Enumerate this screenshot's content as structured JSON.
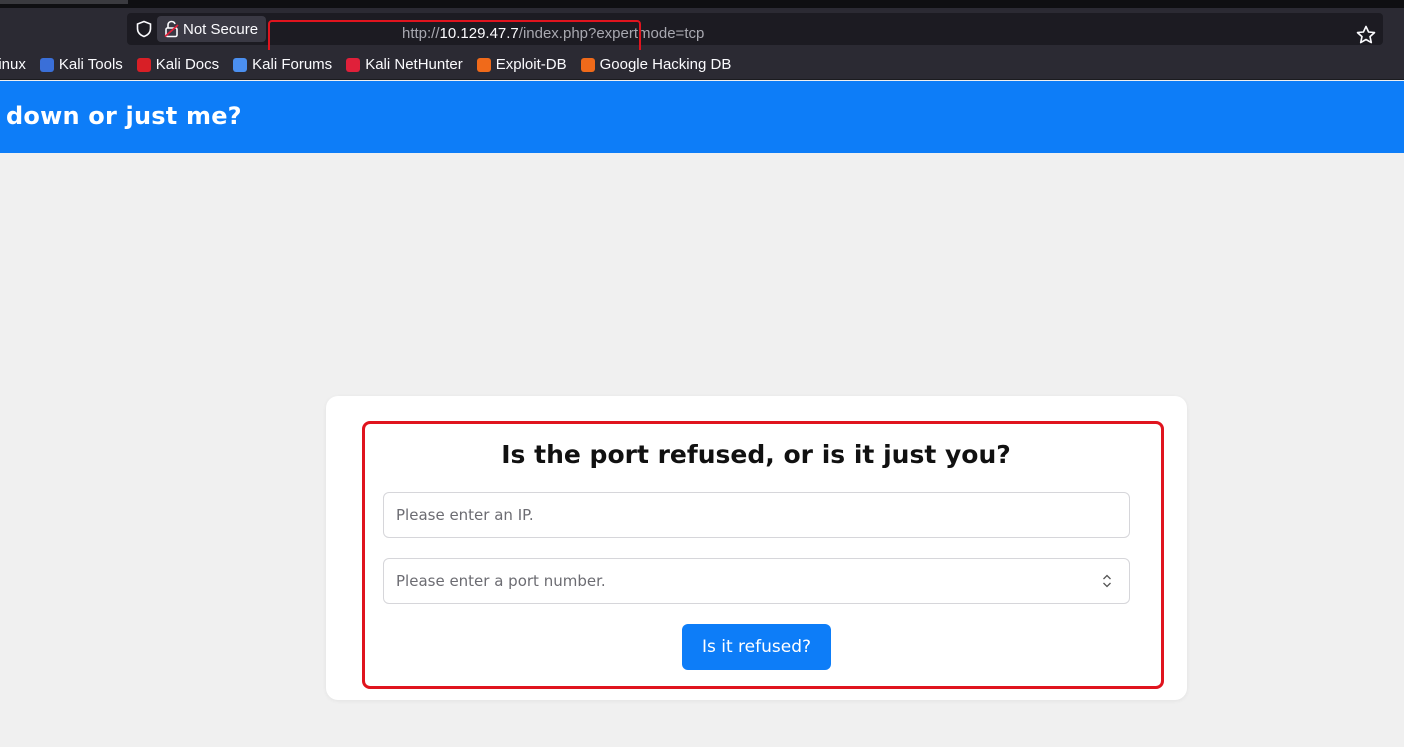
{
  "browser": {
    "security_label": "Not Secure",
    "url_scheme": "http://",
    "url_host": "10.129.47.7",
    "url_path": "/index.php?expertmode=tcp",
    "bookmarks": [
      {
        "label": "Linux",
        "icon": "linux-icon",
        "color": "#2b2a33"
      },
      {
        "label": "Kali Tools",
        "icon": "kali-tools-icon",
        "color": "#3a6fd8"
      },
      {
        "label": "Kali Docs",
        "icon": "kali-docs-icon",
        "color": "#d81f26"
      },
      {
        "label": "Kali Forums",
        "icon": "kali-forums-icon",
        "color": "#4b8ff0"
      },
      {
        "label": "Kali NetHunter",
        "icon": "kali-nethunter-icon",
        "color": "#e0203a"
      },
      {
        "label": "Exploit-DB",
        "icon": "exploit-db-icon",
        "color": "#f06a1a"
      },
      {
        "label": "Google Hacking DB",
        "icon": "google-hacking-db-icon",
        "color": "#f06a1a"
      }
    ]
  },
  "page": {
    "brand": "down or just me?",
    "heading": "Is the port refused, or is it just you?",
    "ip_placeholder": "Please enter an IP.",
    "port_placeholder": "Please enter a port number.",
    "submit_label": "Is it refused?"
  },
  "colors": {
    "accent": "#0d7df8",
    "highlight_box": "#e0141e"
  }
}
